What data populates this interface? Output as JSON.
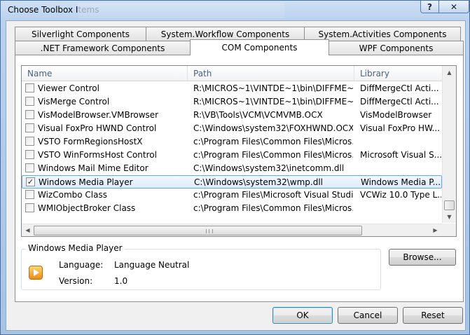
{
  "window": {
    "title": "Choose Toolbox Items",
    "help_button": "?",
    "close_button": "✕"
  },
  "tabs": {
    "row_back": [
      {
        "label": "Silverlight Components"
      },
      {
        "label": "System.Workflow Components"
      },
      {
        "label": "System.Activities Components"
      }
    ],
    "row_front": [
      {
        "label": ".NET Framework Components"
      },
      {
        "label": "COM Components",
        "active": true
      },
      {
        "label": "WPF Components"
      }
    ]
  },
  "list": {
    "columns": [
      "Name",
      "Path",
      "Library"
    ],
    "rows": [
      {
        "checked": false,
        "name": "Viewer Control",
        "path": "R:\\MICROS~1\\VINTDE~1\\bin\\DIFFME~1....",
        "library": "DiffMergeCtl Acti..."
      },
      {
        "checked": false,
        "name": "VisMerge Control",
        "path": "R:\\MICROS~1\\VINTDE~1\\bin\\DIFFME~1....",
        "library": "DiffMergeCtl Acti..."
      },
      {
        "checked": false,
        "name": "VisModelBrowser.VMBrowser",
        "path": "R:\\VB\\Tools\\VCM\\VCMVMB.OCX",
        "library": "VisModelBrowser"
      },
      {
        "checked": false,
        "name": "Visual FoxPro HWND Control",
        "path": "C:\\Windows\\system32\\FOXHWND.OCX",
        "library": "Visual FoxPro HW..."
      },
      {
        "checked": false,
        "name": "VSTO FormRegionsHostX",
        "path": "c:\\Program Files\\Common Files\\Micros...",
        "library": ""
      },
      {
        "checked": false,
        "name": "VSTO WinFormsHost Control",
        "path": "c:\\Program Files\\Common Files\\Micros...",
        "library": "Microsoft Visual S..."
      },
      {
        "checked": false,
        "name": "Windows Mail Mime Editor",
        "path": "C:\\Windows\\system32\\inetcomm.dll",
        "library": ""
      },
      {
        "checked": true,
        "selected": true,
        "name": "Windows Media Player",
        "path": "C:\\Windows\\system32\\wmp.dll",
        "library": "Windows Media P..."
      },
      {
        "checked": false,
        "name": "WizCombo Class",
        "path": "c:\\Program Files\\Microsoft Visual Studio...",
        "library": "VCWiz 10.0 Type L..."
      },
      {
        "checked": false,
        "name": "WMIObjectBroker Class",
        "path": "c:\\Program Files\\Common Files\\Micros...",
        "library": ""
      }
    ]
  },
  "details": {
    "group_title": "Windows Media Player",
    "language_label": "Language:",
    "language_value": "Language Neutral",
    "version_label": "Version:",
    "version_value": "1.0",
    "icon": "media-player-icon"
  },
  "buttons": {
    "browse": "Browse...",
    "ok": "OK",
    "cancel": "Cancel",
    "reset": "Reset"
  }
}
